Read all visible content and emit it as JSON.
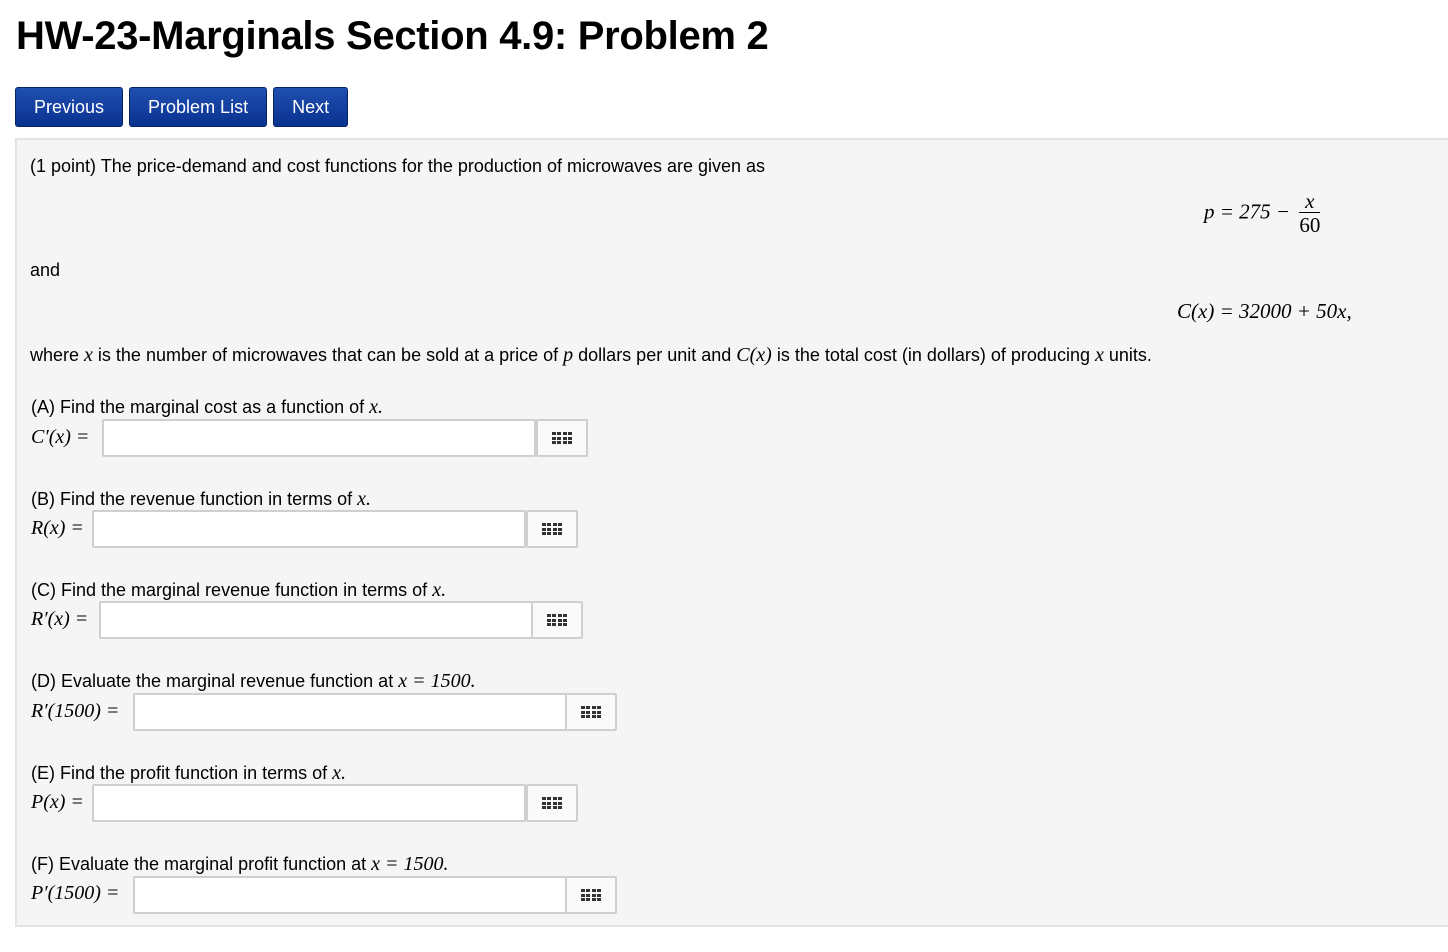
{
  "header": {
    "title": "HW-23-Marginals Section 4.9: Problem 2"
  },
  "nav": {
    "previous_label": "Previous",
    "problem_list_label": "Problem List",
    "next_label": "Next"
  },
  "problem": {
    "intro": "(1 point) The price-demand and cost functions for the production of microwaves are given as",
    "price_eq_lhs": "p = 275 −",
    "price_eq_num": "x",
    "price_eq_den": "60",
    "and_text": "and",
    "cost_eq": "C(x) = 32000 + 50x,",
    "where_parts": [
      "where ",
      "x",
      " is the number of microwaves that can be sold at a price of ",
      "p",
      " dollars per unit and ",
      "C(x)",
      " is the total cost (in dollars) of producing ",
      "x",
      " units."
    ]
  },
  "parts": [
    {
      "question": "(A) Find the marginal cost as a function of ",
      "math": "x.",
      "answer_label": "C′(x) =",
      "value": ""
    },
    {
      "question": "(B) Find the revenue function in terms of ",
      "math": "x.",
      "answer_label": "R(x) =",
      "value": ""
    },
    {
      "question": "(C) Find the marginal revenue function in terms of ",
      "math": "x.",
      "answer_label": "R′(x) =",
      "value": ""
    },
    {
      "question": "(D) Evaluate the marginal revenue function at ",
      "math": "x = 1500.",
      "answer_label": "R′(1500) =",
      "value": ""
    },
    {
      "question": "(E) Find the profit function in terms of ",
      "math": "x.",
      "answer_label": "P(x) =",
      "value": ""
    },
    {
      "question": "(F) Evaluate the marginal profit function at ",
      "math": "x = 1500.",
      "answer_label": "P′(1500) =",
      "value": ""
    }
  ],
  "icons": {
    "equation_editor": "grid-icon"
  }
}
